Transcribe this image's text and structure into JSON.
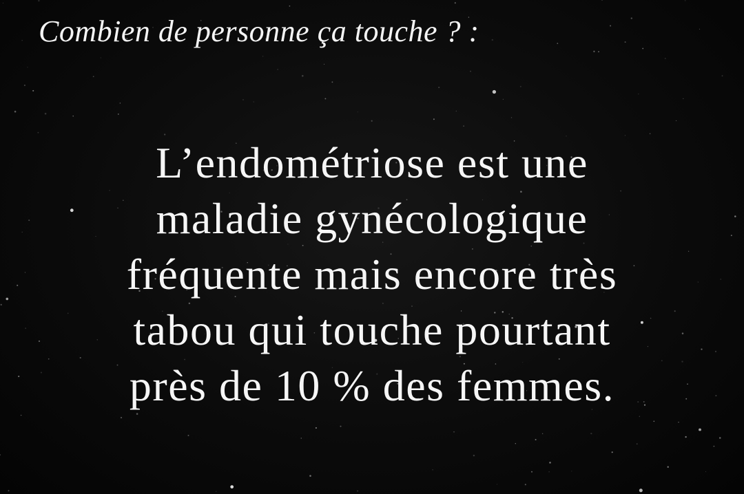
{
  "heading": "Combien de personne ça touche ? :",
  "body": {
    "lines": [
      "L’endométriose est une",
      "maladie gynécologique",
      "fréquente mais encore très",
      "tabou qui touche pourtant",
      "près de 10 % des femmes."
    ]
  },
  "colors": {
    "background": "#000000",
    "text": "#f4f4f4"
  }
}
